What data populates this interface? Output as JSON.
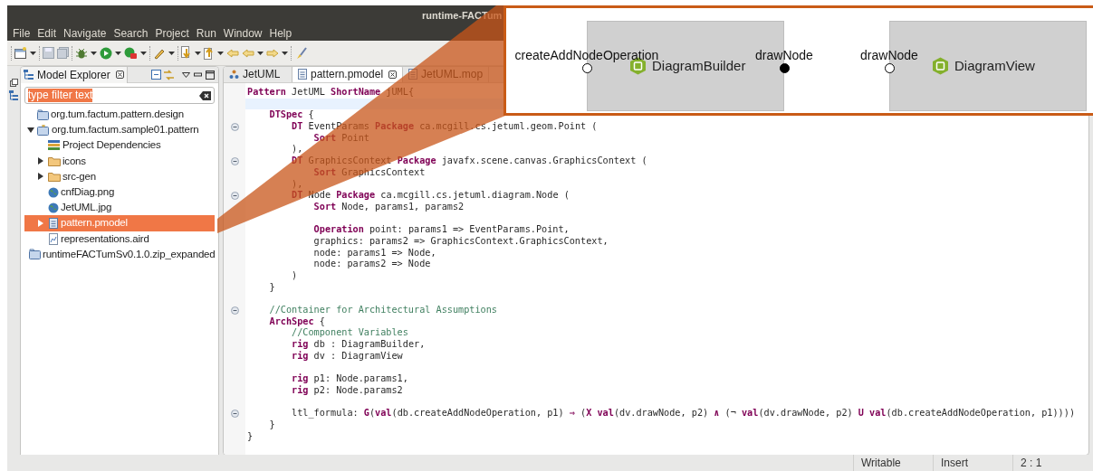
{
  "window": {
    "title": "runtime-FACTum"
  },
  "menu": [
    "File",
    "Edit",
    "Navigate",
    "Search",
    "Project",
    "Run",
    "Window",
    "Help"
  ],
  "explorer": {
    "title": "Model Explorer",
    "filter": {
      "value": "type filter text",
      "text_selected": true
    },
    "tree": [
      {
        "label": "org.tum.factum.pattern.design",
        "kind": "project",
        "selected": false
      },
      {
        "label": "org.tum.factum.sample01.pattern",
        "kind": "open-project",
        "expanded": true,
        "selected": false,
        "children": [
          {
            "label": "Project Dependencies",
            "kind": "library",
            "selected": false
          },
          {
            "label": "icons",
            "kind": "folder",
            "expanded": false,
            "selected": false
          },
          {
            "label": "src-gen",
            "kind": "folder",
            "expanded": false,
            "selected": false
          },
          {
            "label": "cnfDiag.png",
            "kind": "image",
            "selected": false
          },
          {
            "label": "JetUML.jpg",
            "kind": "image",
            "selected": false
          },
          {
            "label": "pattern.pmodel",
            "kind": "model",
            "expanded": false,
            "selected": true
          },
          {
            "label": "representations.aird",
            "kind": "diagram",
            "selected": false
          }
        ]
      },
      {
        "label": "runtimeFACTumSv0.1.0.zip_expanded",
        "kind": "project",
        "selected": false
      }
    ]
  },
  "editor": {
    "tabs": [
      {
        "label": "JetUML",
        "kind": "pattern",
        "selected": false
      },
      {
        "label": "pattern.pmodel",
        "kind": "file",
        "selected": true
      },
      {
        "label": "JetUML.mop",
        "kind": "file",
        "selected": false
      }
    ],
    "lines": [
      {
        "kind": "code",
        "fold": false,
        "current": false,
        "text": "**Pattern** JetUML **ShortName** jUML{"
      },
      {
        "kind": "blank",
        "fold": false,
        "current": true
      },
      {
        "kind": "code",
        "fold": false,
        "current": false,
        "text": "    **DTSpec** {"
      },
      {
        "kind": "code",
        "fold": true,
        "current": false,
        "text": "        **DT** EventParams **Package** ca.mcgill.cs.jetuml.geom.Point ("
      },
      {
        "kind": "code",
        "fold": false,
        "current": false,
        "text": "            **Sort** Point"
      },
      {
        "kind": "code",
        "fold": false,
        "current": false,
        "text": "        ),"
      },
      {
        "kind": "code",
        "fold": true,
        "current": false,
        "text": "        **DT** GraphicsContext **Package** javafx.scene.canvas.GraphicsContext ("
      },
      {
        "kind": "code",
        "fold": false,
        "current": false,
        "text": "            **Sort** GraphicsContext"
      },
      {
        "kind": "code",
        "fold": false,
        "current": false,
        "text": "        ),"
      },
      {
        "kind": "code",
        "fold": true,
        "current": false,
        "text": "        **DT** Node **Package** ca.mcgill.cs.jetuml.diagram.Node ("
      },
      {
        "kind": "code",
        "fold": false,
        "current": false,
        "text": "            **Sort** Node, params1, params2"
      },
      {
        "kind": "blank",
        "fold": false,
        "current": false
      },
      {
        "kind": "code",
        "fold": false,
        "current": false,
        "text": "            **Operation** point: params1 => EventParams.Point,"
      },
      {
        "kind": "code",
        "fold": false,
        "current": false,
        "text": "            graphics: params2 => GraphicsContext.GraphicsContext,"
      },
      {
        "kind": "code",
        "fold": false,
        "current": false,
        "text": "            node: params1 => Node,"
      },
      {
        "kind": "code",
        "fold": false,
        "current": false,
        "text": "            node: params2 => Node"
      },
      {
        "kind": "code",
        "fold": false,
        "current": false,
        "text": "        )"
      },
      {
        "kind": "code",
        "fold": false,
        "current": false,
        "text": "    }"
      },
      {
        "kind": "blank",
        "fold": false,
        "current": false
      },
      {
        "kind": "comment",
        "fold": true,
        "current": false,
        "text": "    //Container for Architectural Assumptions"
      },
      {
        "kind": "code",
        "fold": false,
        "current": false,
        "text": "    **ArchSpec** {"
      },
      {
        "kind": "comment",
        "fold": false,
        "current": false,
        "text": "        //Component Variables"
      },
      {
        "kind": "code",
        "fold": false,
        "current": false,
        "text": "        **rig** db : DiagramBuilder,"
      },
      {
        "kind": "code",
        "fold": false,
        "current": false,
        "text": "        **rig** dv : DiagramView"
      },
      {
        "kind": "blank",
        "fold": false,
        "current": false
      },
      {
        "kind": "code",
        "fold": false,
        "current": false,
        "text": "        **rig** p1: Node.params1,"
      },
      {
        "kind": "code",
        "fold": false,
        "current": false,
        "text": "        **rig** p2: Node.params2"
      },
      {
        "kind": "blank",
        "fold": false,
        "current": false
      },
      {
        "kind": "code",
        "fold": true,
        "current": false,
        "text": "        ltl_formula: **G**(**val**(db.createAddNodeOperation, p1) **⇒** (**X** **val**(dv.drawNode, p2) **∧** (¬ **val**(dv.drawNode, p2) **U** **val**(db.createAddNodeOperation, p1))))"
      },
      {
        "kind": "code",
        "fold": false,
        "current": false,
        "text": "    }"
      },
      {
        "kind": "code",
        "fold": false,
        "current": false,
        "text": "}"
      }
    ]
  },
  "status_bar": [
    "Writable",
    "Insert",
    "2 : 1"
  ],
  "inset": {
    "components": [
      {
        "name": "DiagramBuilder",
        "ports": [
          {
            "label": "createAddNodeOperation",
            "kind": "left",
            "filled": false
          },
          {
            "label": "drawNode",
            "kind": "right",
            "filled": true
          }
        ]
      },
      {
        "name": "DiagramView",
        "ports": [
          {
            "label": "drawNode",
            "kind": "left",
            "filled": false
          }
        ]
      }
    ]
  }
}
